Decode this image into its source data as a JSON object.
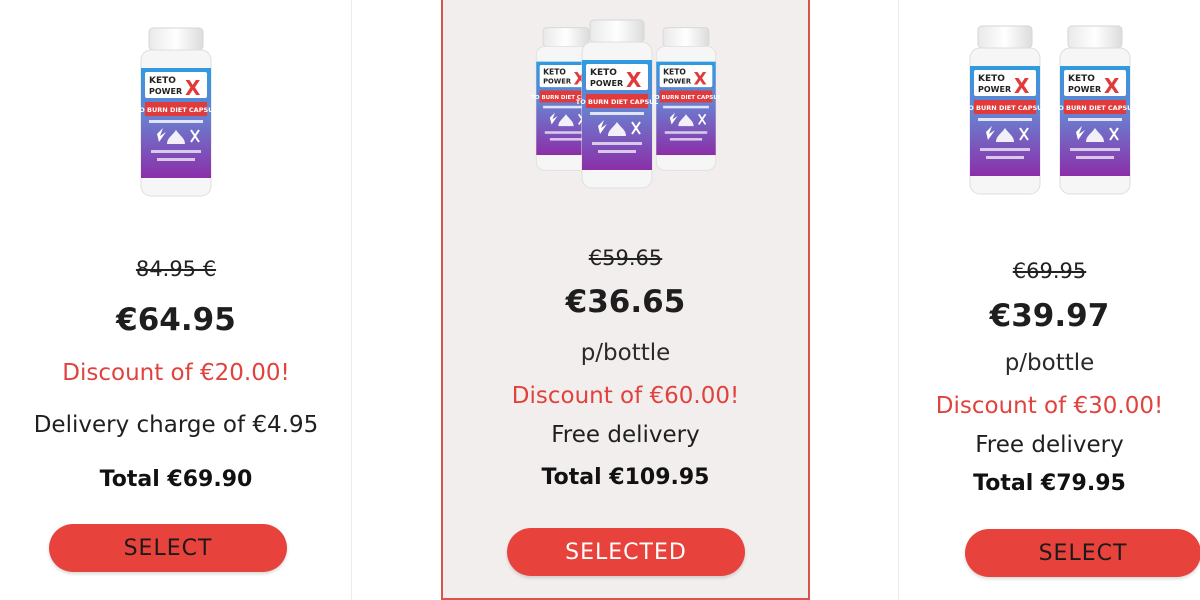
{
  "brand": {
    "line1": "KETO",
    "line2": "POWER",
    "mark": "X",
    "banner": "KETO BURN DIET CAPSULES"
  },
  "offers": [
    {
      "old_price": "84.95 €",
      "price": "€64.95",
      "discount": "Discount of €20.00!",
      "delivery": "Delivery charge of €4.95",
      "total": "Total €69.90",
      "button": "SELECT",
      "bottles": 1
    },
    {
      "old_price": "€59.65",
      "price": "€36.65",
      "per_bottle": "p/bottle",
      "discount": "Discount of €60.00!",
      "delivery": "Free delivery",
      "total": "Total €109.95",
      "button": "SELECTED",
      "selected": true,
      "bottles": 3
    },
    {
      "old_price": "€69.95",
      "price": "€39.97",
      "per_bottle": "p/bottle",
      "discount": "Discount of €30.00!",
      "delivery": "Free delivery",
      "total": "Total €79.95",
      "button": "SELECT",
      "bottles": 2
    }
  ],
  "colors": {
    "accent": "#e8423c",
    "discount": "#e0433e",
    "selected_bg": "#f3eeee",
    "label_blue": "#2f9be0",
    "label_purple": "#8b2fa8"
  }
}
